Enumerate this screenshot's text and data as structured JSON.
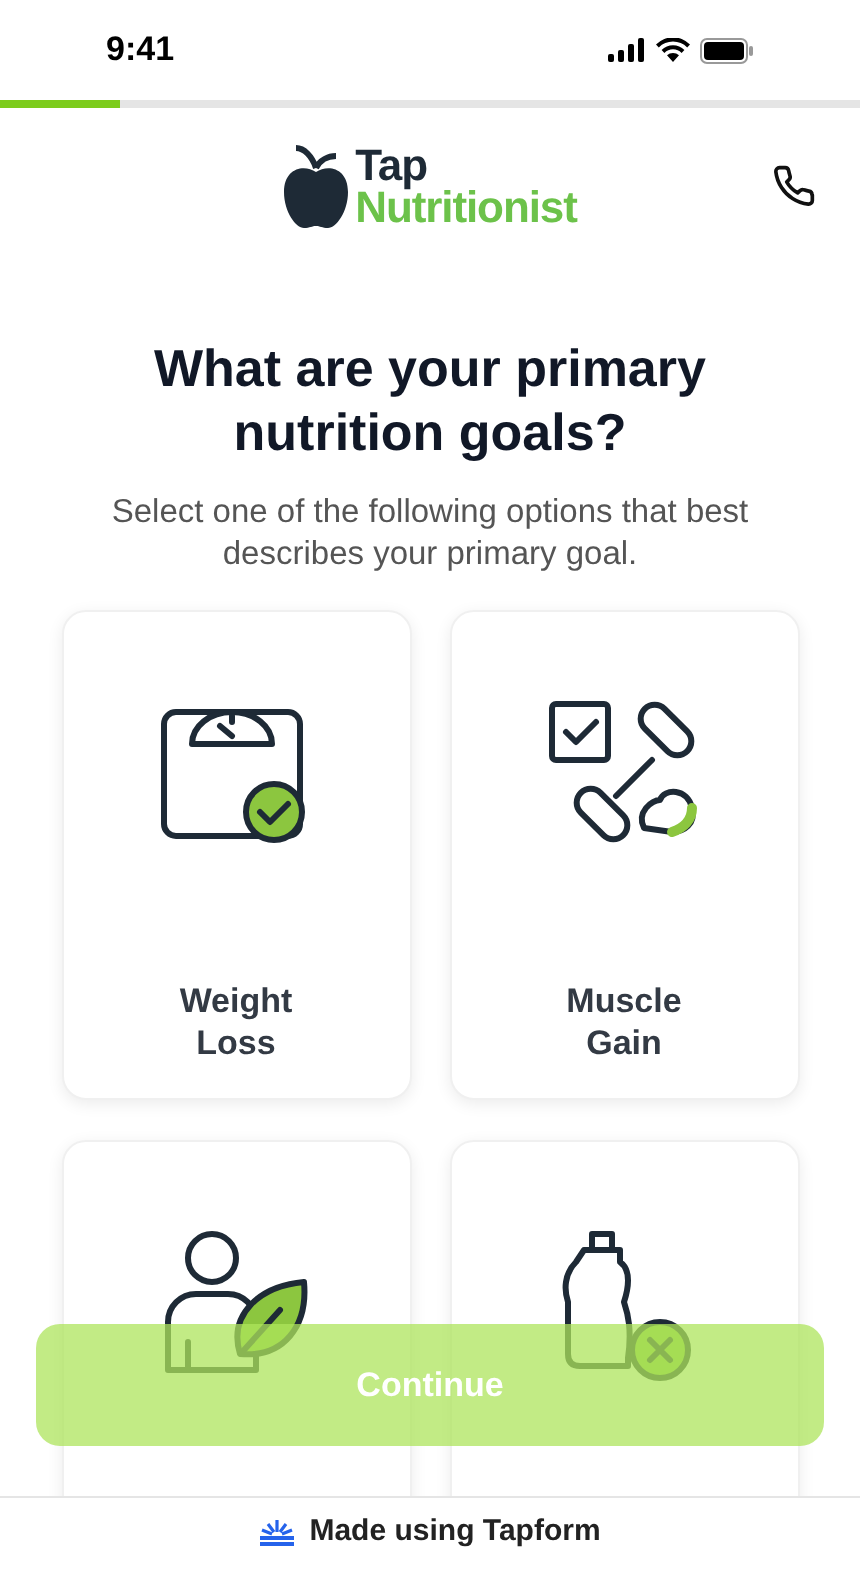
{
  "status_bar": {
    "time": "9:41"
  },
  "progress": {
    "level": 0.14
  },
  "brand": {
    "line_1": "Tap",
    "line_2": "Nutritionist"
  },
  "title": "What are your primary nutrition goals?",
  "subtitle": "Select one of the following options that best describes your primary goal.",
  "options": [
    {
      "kind": "scale",
      "label": [
        "Weight",
        "Loss"
      ]
    },
    {
      "kind": "dumbbell",
      "label": [
        "Muscle",
        "Gain"
      ]
    },
    {
      "kind": "person-leaf"
    },
    {
      "kind": "bottle"
    }
  ],
  "continue_button": {
    "label": "Continue",
    "disabled": true
  },
  "footer": {
    "text": "Made using Tapform"
  }
}
